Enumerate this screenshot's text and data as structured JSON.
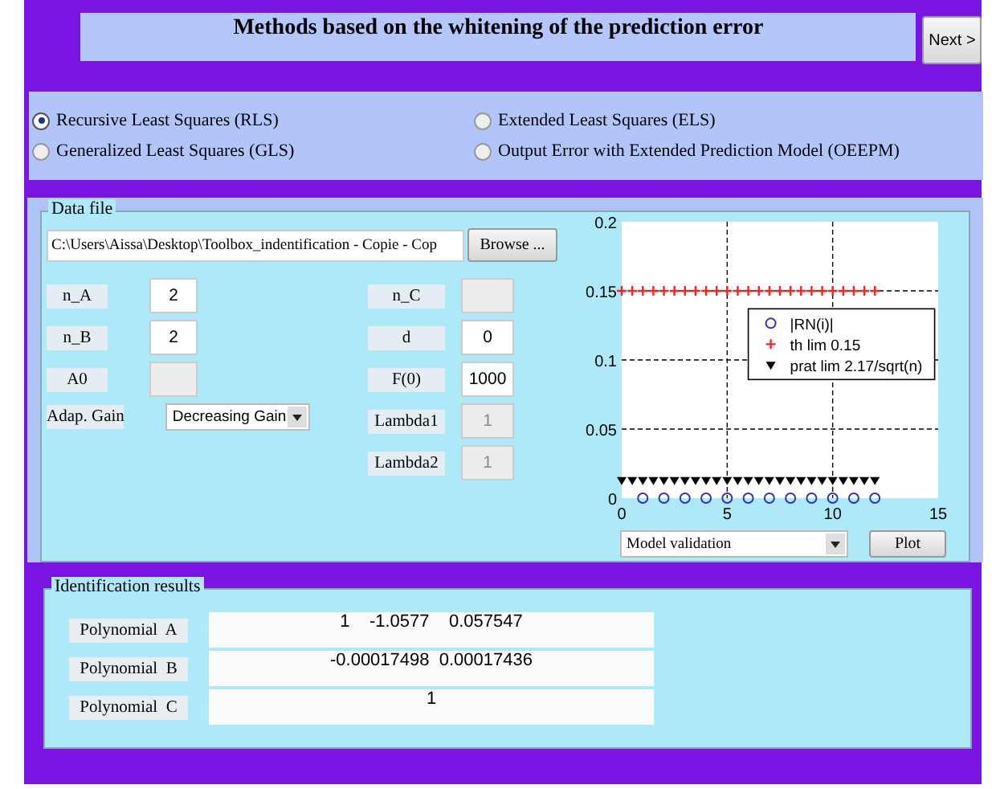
{
  "title": "Methods based on the whitening of the prediction error",
  "next_button": "Next >",
  "methods": [
    {
      "label": "Recursive Least Squares (RLS)",
      "selected": true
    },
    {
      "label": "Extended Least Squares (ELS)",
      "selected": false
    },
    {
      "label": "Generalized Least Squares (GLS)",
      "selected": false
    },
    {
      "label": "Output Error with Extended Prediction Model (OEEPM)",
      "selected": false
    }
  ],
  "data_file": {
    "legend": "Data file",
    "path": "C:\\Users\\Aissa\\Desktop\\Toolbox_indentification - Copie - Cop",
    "browse_button": "Browse ...",
    "params_left": [
      {
        "label": "n_A",
        "kind": "field",
        "value": "2",
        "disabled": false
      },
      {
        "label": "n_B",
        "kind": "field",
        "value": "2",
        "disabled": false
      },
      {
        "label": "A0",
        "kind": "field",
        "disabled": true
      },
      {
        "label": "Adap. Gain",
        "kind": "dropdown",
        "value": "Decreasing Gain"
      }
    ],
    "params_right": [
      {
        "label": "n_C",
        "kind": "field",
        "disabled": true
      },
      {
        "label": "d",
        "kind": "field",
        "value": "0",
        "disabled": false
      },
      {
        "label": "F(0)",
        "kind": "field",
        "value": "1000",
        "disabled": false
      },
      {
        "label": "Lambda1",
        "kind": "field",
        "value": "1",
        "disabled": true
      },
      {
        "label": "Lambda2",
        "kind": "field",
        "value": "1",
        "disabled": true
      }
    ],
    "chart_data": {
      "type": "scatter",
      "grid": true,
      "legend": true,
      "x": [
        0,
        0.5,
        1,
        1.5,
        2,
        2.5,
        3,
        3.5,
        4,
        4.5,
        5,
        5.5,
        6,
        6.5,
        7,
        7.5,
        8,
        8.5,
        9,
        9.5,
        10,
        10.5,
        11,
        11.5,
        12
      ],
      "xlim": [
        0,
        15
      ],
      "ylim": [
        0,
        0.2
      ],
      "xticks": [
        0,
        5,
        10,
        15
      ],
      "yticks": [
        0,
        0.05,
        0.1,
        0.15,
        0.2
      ],
      "series": [
        {
          "name": "|RN(i)|",
          "color": "#3333aa",
          "marker": "circle",
          "values": [
            null,
            null,
            0,
            null,
            0,
            null,
            0,
            null,
            0,
            null,
            0,
            null,
            0,
            null,
            0,
            null,
            0,
            null,
            0,
            null,
            0,
            null,
            0,
            null,
            0
          ]
        },
        {
          "name": "th lim 0.15",
          "color": "#ff2020",
          "marker": "plus",
          "values": [
            0.15,
            0.15,
            0.15,
            0.15,
            0.15,
            0.15,
            0.15,
            0.15,
            0.15,
            0.15,
            0.15,
            0.15,
            0.15,
            0.15,
            0.15,
            0.15,
            0.15,
            0.15,
            0.15,
            0.15,
            0.15,
            0.15,
            0.15,
            0.15,
            0.15
          ]
        },
        {
          "name": "prat lim 2.17/sqrt(n)",
          "color": "#000000",
          "marker": "triangle",
          "values": [
            0.013,
            0.013,
            0.013,
            0.013,
            0.013,
            0.013,
            0.013,
            0.013,
            0.013,
            0.013,
            0.013,
            0.013,
            0.013,
            0.013,
            0.013,
            0.013,
            0.013,
            0.013,
            0.013,
            0.013,
            0.013,
            0.013,
            0.013,
            0.013,
            0.013
          ]
        }
      ]
    },
    "plot_type": "Model validation",
    "plot_button": "Plot"
  },
  "results": {
    "legend": "Identification results",
    "rows": [
      {
        "label": "Polynomial  A",
        "value": "1    -1.0577    0.057547"
      },
      {
        "label": "Polynomial  B",
        "value": "-0.00017498  0.00017436"
      },
      {
        "label": "Polynomial  C",
        "value": "1"
      }
    ]
  }
}
